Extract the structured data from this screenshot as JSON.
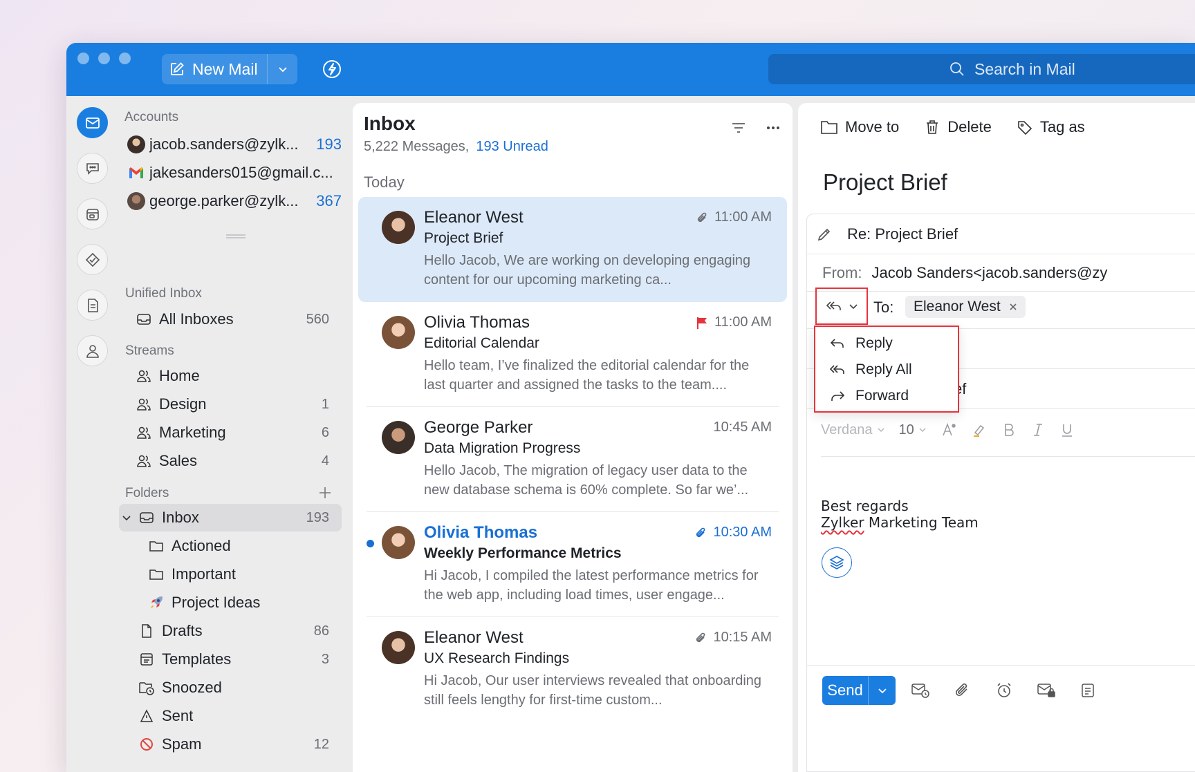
{
  "titlebar": {
    "new_mail_label": "New Mail",
    "search_placeholder": "Search in Mail"
  },
  "colors": {
    "accent": "#1a7ee1",
    "link": "#1a6fd4",
    "highlight": "#e5343d",
    "selected_row": "#dce9f8"
  },
  "sidebar": {
    "accounts_title": "Accounts",
    "accounts": [
      {
        "email": "jacob.sanders@zylk...",
        "count": "193",
        "icon": "avatar"
      },
      {
        "email": "jakesanders015@gmail.c...",
        "count": "",
        "icon": "gmail-icon"
      },
      {
        "email": "george.parker@zylk...",
        "count": "367",
        "icon": "avatar"
      }
    ],
    "unified_title": "Unified Inbox",
    "all_inboxes": {
      "label": "All Inboxes",
      "count": "560"
    },
    "streams_title": "Streams",
    "streams": [
      {
        "label": "Home",
        "count": ""
      },
      {
        "label": "Design",
        "count": "1"
      },
      {
        "label": "Marketing",
        "count": "6"
      },
      {
        "label": "Sales",
        "count": "4"
      }
    ],
    "folders_title": "Folders",
    "folders": [
      {
        "label": "Inbox",
        "count": "193"
      },
      {
        "label": "Actioned",
        "count": ""
      },
      {
        "label": "Important",
        "count": ""
      },
      {
        "label": "Project Ideas",
        "count": ""
      },
      {
        "label": "Drafts",
        "count": "86"
      },
      {
        "label": "Templates",
        "count": "3"
      },
      {
        "label": "Snoozed",
        "count": ""
      },
      {
        "label": "Sent",
        "count": ""
      },
      {
        "label": "Spam",
        "count": "12"
      }
    ]
  },
  "list": {
    "title": "Inbox",
    "messages_count": "5,222 Messages,",
    "unread_count": "193 Unread",
    "group_label": "Today",
    "messages": [
      {
        "from": "Eleanor West",
        "subject": "Project Brief",
        "preview": "Hello Jacob, We are working on developing engaging content for our upcoming marketing ca...",
        "time": "11:00 AM",
        "marker": "attachment"
      },
      {
        "from": "Olivia Thomas",
        "subject": "Editorial Calendar",
        "preview": "Hello team, I’ve finalized the editorial calendar for the last quarter and assigned the tasks to the team....",
        "time": "11:00 AM",
        "marker": "flag"
      },
      {
        "from": "George Parker",
        "subject": "Data Migration Progress",
        "preview": "Hello Jacob, The migration of legacy user data to the new database schema is 60% complete. So far we’...",
        "time": "10:45 AM",
        "marker": ""
      },
      {
        "from": "Olivia Thomas",
        "subject": "Weekly Performance Metrics",
        "preview": "Hi Jacob, I compiled the latest performance metrics for the web app, including load times, user engage...",
        "time": "10:30 AM",
        "marker": "attachment"
      },
      {
        "from": "Eleanor West",
        "subject": "UX Research Findings",
        "preview": "Hi Jacob, Our user interviews revealed that onboarding still feels lengthy for first-time custom...",
        "time": "10:15 AM",
        "marker": "attachment"
      }
    ]
  },
  "pane": {
    "actions": {
      "move": "Move to",
      "delete": "Delete",
      "tag": "Tag as"
    },
    "title": "Project Brief",
    "compose": {
      "subject": "Re: Project Brief",
      "from_label": "From:",
      "from_value": "Jacob Sanders<jacob.sanders@zy",
      "to_label": "To:",
      "to_chip": "Eleanor West",
      "subject_tail": "ef",
      "menu": [
        "Reply",
        "Reply All",
        "Forward"
      ],
      "font_name": "Verdana",
      "font_size": "10",
      "signature_line1": "Best regards",
      "signature_word": "Zylker",
      "signature_rest": " Marketing Team",
      "send_label": "Send"
    }
  }
}
